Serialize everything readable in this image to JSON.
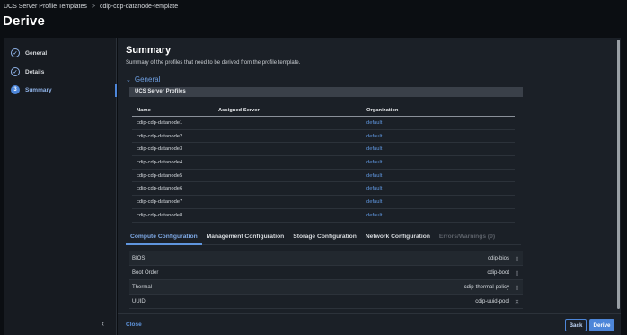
{
  "breadcrumb": {
    "parent": "UCS Server Profile Templates",
    "separator": ">",
    "current": "cdip-cdp-datanode-template"
  },
  "page_title": "Derive",
  "steps": [
    {
      "label": "General",
      "icon": "check-circle-icon",
      "marker": "✓"
    },
    {
      "label": "Details",
      "icon": "check-circle-icon",
      "marker": "✓"
    },
    {
      "label": "Summary",
      "icon": "step-number-icon",
      "marker": "3"
    }
  ],
  "summary": {
    "title": "Summary",
    "subtitle": "Summary of the profiles that need to be derived from the profile template.",
    "section": "General",
    "band": "UCS Server Profiles",
    "columns": [
      "Name",
      "Assigned Server",
      "Organization"
    ],
    "rows": [
      {
        "name": "cdip-cdp-datanode1",
        "server": "",
        "org": "default"
      },
      {
        "name": "cdip-cdp-datanode2",
        "server": "",
        "org": "default"
      },
      {
        "name": "cdip-cdp-datanode3",
        "server": "",
        "org": "default"
      },
      {
        "name": "cdip-cdp-datanode4",
        "server": "",
        "org": "default"
      },
      {
        "name": "cdip-cdp-datanode5",
        "server": "",
        "org": "default"
      },
      {
        "name": "cdip-cdp-datanode6",
        "server": "",
        "org": "default"
      },
      {
        "name": "cdip-cdp-datanode7",
        "server": "",
        "org": "default"
      },
      {
        "name": "cdip-cdp-datanode8",
        "server": "",
        "org": "default"
      }
    ]
  },
  "tabs": [
    {
      "label": "Compute Configuration",
      "state": "active"
    },
    {
      "label": "Management Configuration",
      "state": "normal"
    },
    {
      "label": "Storage Configuration",
      "state": "normal"
    },
    {
      "label": "Network Configuration",
      "state": "normal"
    },
    {
      "label": "Errors/Warnings (0)",
      "state": "disabled"
    }
  ],
  "compute": [
    {
      "label": "BIOS",
      "value": "cdip-bios",
      "icon": "document-icon"
    },
    {
      "label": "Boot Order",
      "value": "cdip-boot",
      "icon": "document-icon"
    },
    {
      "label": "Thermal",
      "value": "cdip-thermal-policy",
      "icon": "document-icon"
    },
    {
      "label": "UUID",
      "value": "cdip-uuid-pool",
      "icon": "close-icon"
    }
  ],
  "footer": {
    "close": "Close",
    "back": "Back",
    "derive": "Derive"
  },
  "colors": {
    "accent": "#4d86d9",
    "link": "#5f95de",
    "background": "#0b0e12",
    "panel": "#1b2027"
  }
}
